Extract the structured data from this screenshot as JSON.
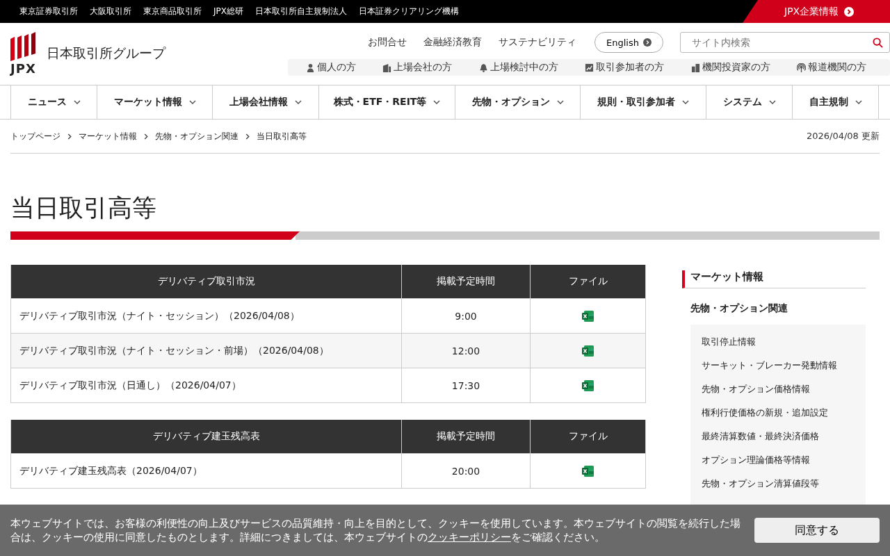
{
  "top_bar": {
    "links": [
      "東京証券取引所",
      "大阪取引所",
      "東京商品取引所",
      "JPX総研",
      "日本取引所自主規制法人",
      "日本証券クリアリング機構"
    ],
    "corporate_link": "JPX企業情報"
  },
  "header": {
    "logo_text": "JPX",
    "site_name": "日本取引所グループ",
    "utility_links": [
      "お問合せ",
      "金融経済教育",
      "サステナビリティ"
    ],
    "language_button": "English",
    "search": {
      "placeholder": "サイト内検索"
    },
    "audience_links": [
      "個人の方",
      "上場会社の方",
      "上場検討中の方",
      "取引参加者の方",
      "機関投資家の方",
      "報道機関の方"
    ]
  },
  "nav": {
    "items": [
      "ニュース",
      "マーケット情報",
      "上場会社情報",
      "株式・ETF・REIT等",
      "先物・オプション",
      "規則・取引参加者",
      "システム",
      "自主規制"
    ]
  },
  "breadcrumb": {
    "items": [
      "トップページ",
      "マーケット情報",
      "先物・オプション関連",
      "当日取引高等"
    ],
    "updated": "2026/04/08 更新"
  },
  "page_title": "当日取引高等",
  "tables": [
    {
      "columns": [
        "デリバティブ取引市況",
        "掲載予定時間",
        "ファイル"
      ],
      "rows": [
        {
          "name": "デリバティブ取引市況（ナイト・セッション）（2026/04/08）",
          "time": "9:00"
        },
        {
          "name": "デリバティブ取引市況（ナイト・セッション・前場）（2026/04/08）",
          "time": "12:00"
        },
        {
          "name": "デリバティブ取引市況（日通し）（2026/04/07）",
          "time": "17:30"
        }
      ]
    },
    {
      "columns": [
        "デリバティブ建玉残高表",
        "掲載予定時間",
        "ファイル"
      ],
      "rows": [
        {
          "name": "デリバティブ建玉残高表（2026/04/07）",
          "time": "20:00"
        }
      ]
    }
  ],
  "sidebar": {
    "heading": "マーケット情報",
    "subheading": "先物・オプション関連",
    "items": [
      "取引停止情報",
      "サーキット・ブレーカー発動情報",
      "先物・オプション価格情報",
      "権利行使価格の新規・追加設定",
      "最終清算数値・最終決済価格",
      "オプション理論価格等情報",
      "先物・オプション清算値段等"
    ]
  },
  "cookie_banner": {
    "text_before": "本ウェブサイトでは、お客様の利便性の向上及びサービスの品質維持・向上を目的として、クッキーを使用しています。本ウェブサイトの閲覧を続行した場合は、クッキーの使用に同意したものとします。詳細につきましては、本ウェブサイトの",
    "link": "クッキーポリシー",
    "text_after": "をご確認ください。",
    "button": "同意する"
  }
}
